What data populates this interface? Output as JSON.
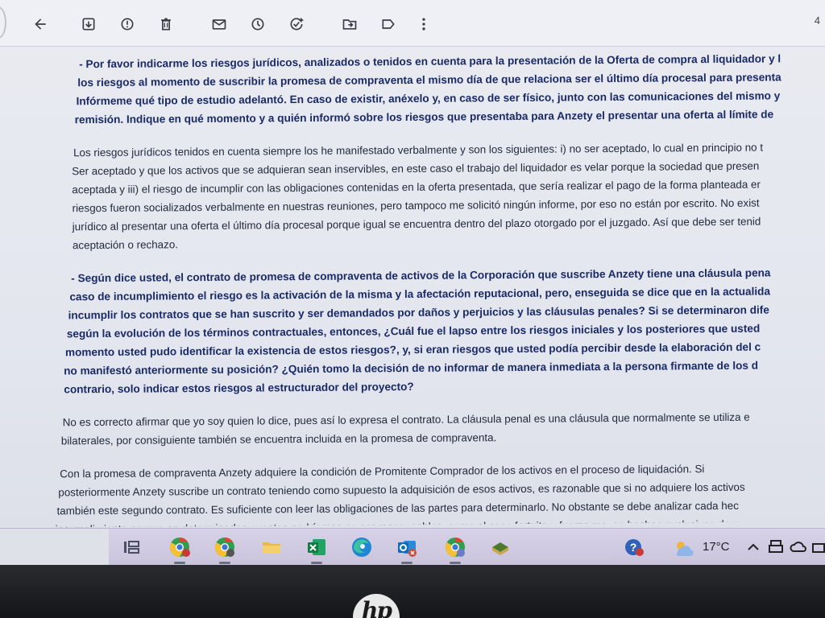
{
  "toolbar": {
    "icons": [
      "back-arrow-icon",
      "archive-icon",
      "report-spam-icon",
      "delete-icon",
      "mark-unread-icon",
      "snooze-icon",
      "add-task-icon",
      "move-to-icon",
      "label-icon",
      "more-options-icon"
    ],
    "count": "4"
  },
  "email": {
    "paragraphs": [
      {
        "type": "question",
        "lines": [
          "- Por favor indicarme los riesgos jurídicos, analizados o tenidos en cuenta para la presentación de la Oferta de compra al liquidador y l",
          "los riesgos al momento de suscribir la promesa de compraventa el mismo día de que relaciona ser el último día procesal para presenta",
          "Infórmeme qué tipo de estudio adelantó. En caso de existir, anéxelo y, en caso de ser físico, junto con las comunicaciones del mismo y",
          "remisión. Indique en qué momento y a quién informó sobre los riesgos que presentaba para Anzety el presentar una oferta al límite de"
        ]
      },
      {
        "type": "answer",
        "lines": [
          "Los riesgos jurídicos tenidos en cuenta siempre los he manifestado verbalmente y son los siguientes: i) no ser aceptado, lo cual en principio no t",
          "Ser aceptado y que los activos que se adquieran sean inservibles, en este caso el trabajo del liquidador es velar porque la sociedad que presen",
          "aceptada y iii) el riesgo de incumplir con las obligaciones contenidas en la oferta presentada, que sería realizar el pago de la forma planteada er",
          "riesgos fueron socializados verbalmente en nuestras reuniones, pero tampoco me solicitó ningún informe, por eso no están por escrito. No exist",
          "jurídico al presentar una oferta el último día procesal porque igual se encuentra dentro del plazo otorgado por el juzgado. Así que debe ser tenid",
          "aceptación o rechazo."
        ]
      },
      {
        "type": "question",
        "lines": [
          "- Según dice usted, el contrato de promesa de compraventa de activos de la Corporación que suscribe Anzety tiene una cláusula pena",
          "caso de incumplimiento el riesgo es la activación de la misma y la afectación reputacional, pero, enseguida se dice que en la actualida",
          "incumplir los contratos que se han suscrito y ser demandados por daños y perjuicios y las cláusulas penales? Si se determinaron dife",
          "según la evolución de los términos contractuales, entonces, ¿Cuál fue el lapso entre los riesgos iniciales y los posteriores que usted",
          "momento usted pudo identificar la existencia de estos riesgos?, y, si eran riesgos que usted podía percibir desde la elaboración del c",
          "no manifestó anteriormente su posición? ¿Quién tomo la decisión de no informar de manera inmediata a la persona firmante de los d",
          "contrario, solo indicar estos riesgos al estructurador del proyecto?"
        ]
      },
      {
        "type": "answer",
        "lines": [
          "No es correcto afirmar que yo soy quien lo dice, pues así lo expresa el contrato. La cláusula penal es una cláusula que normalmente se utiliza e",
          "bilaterales, por consiguiente también se encuentra incluida en la promesa de compraventa."
        ]
      },
      {
        "type": "answer",
        "lines": [
          "Con la promesa de compraventa Anzety adquiere la condición de Promitente Comprador de los activos en el proceso de liquidación. Si",
          "posteriormente Anzety suscribe un contrato teniendo como supuesto la adquisición de esos activos, es razonable que si no adquiere los activos",
          "también este segundo contrato. Es suficiente con leer las obligaciones de las partes para determinarlo. No obstante se debe analizar cada hec",
          "incumplimiento porque en determinados eventos podríamos no ser responsables, como el caso fortuito y fuerza mayor, hechos exclusivos de u"
        ]
      }
    ]
  },
  "taskbar": {
    "apps": [
      "task-view-icon",
      "chrome-profile-icon",
      "chrome-icon",
      "file-explorer-icon",
      "excel-icon",
      "edge-icon",
      "outlook-icon",
      "chrome-alt-icon",
      "book-app-icon"
    ],
    "tray": {
      "temperature": "17°C"
    }
  },
  "bezel": {
    "logo": "hp"
  }
}
